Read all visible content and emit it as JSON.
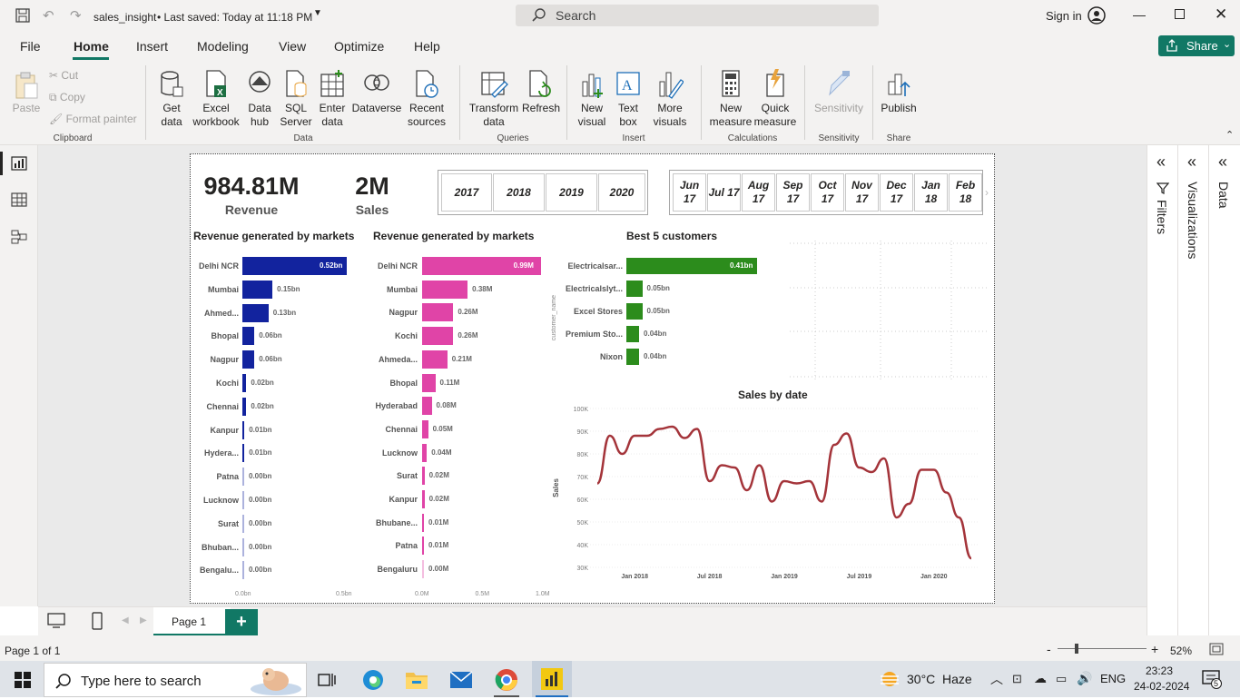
{
  "titlebar": {
    "file_name": "sales_insight",
    "saved_status": "• Last saved: Today at 11:18 PM",
    "search_placeholder": "Search",
    "sign_in": "Sign in"
  },
  "menu": {
    "tabs": [
      "File",
      "Home",
      "Insert",
      "Modeling",
      "View",
      "Optimize",
      "Help"
    ],
    "active_tab": "Home",
    "share_label": "Share"
  },
  "ribbon": {
    "clipboard": {
      "paste": "Paste",
      "cut": "Cut",
      "copy": "Copy",
      "format_painter": "Format painter",
      "group": "Clipboard"
    },
    "data": {
      "get_data": "Get data",
      "excel": "Excel workbook",
      "data_hub": "Data hub",
      "sql": "SQL Server",
      "enter_data": "Enter data",
      "dataverse": "Dataverse",
      "recent": "Recent sources",
      "group": "Data"
    },
    "queries": {
      "transform": "Transform data",
      "refresh": "Refresh",
      "group": "Queries"
    },
    "insert": {
      "new_visual": "New visual",
      "text_box": "Text box",
      "more_visuals": "More visuals",
      "group": "Insert"
    },
    "calculations": {
      "new_measure": "New measure",
      "quick_measure": "Quick measure",
      "group": "Calculations"
    },
    "sensitivity": {
      "label": "Sensitivity",
      "group": "Sensitivity"
    },
    "share": {
      "publish": "Publish",
      "group": "Share"
    }
  },
  "report": {
    "kpi_revenue": {
      "value": "984.81M",
      "label": "Revenue"
    },
    "kpi_sales": {
      "value": "2M",
      "label": "Sales"
    },
    "year_slicer": [
      "2017",
      "2018",
      "2019",
      "2020"
    ],
    "month_slicer": [
      "Jun 17",
      "Jul 17",
      "Aug 17",
      "Sep 17",
      "Oct 17",
      "Nov 17",
      "Dec 17",
      "Jan 18",
      "Feb 18"
    ]
  },
  "chart_data": [
    {
      "type": "bar",
      "title": "Revenue generated by markets",
      "categories": [
        "Delhi NCR",
        "Mumbai",
        "Ahmed...",
        "Bhopal",
        "Nagpur",
        "Kochi",
        "Chennai",
        "Kanpur",
        "Hydera...",
        "Patna",
        "Lucknow",
        "Surat",
        "Bhuban...",
        "Bengalu..."
      ],
      "values": [
        0.52,
        0.15,
        0.13,
        0.06,
        0.06,
        0.02,
        0.02,
        0.01,
        0.01,
        0.0,
        0.0,
        0.0,
        0.0,
        0.0
      ],
      "value_labels": [
        "0.52bn",
        "0.15bn",
        "0.13bn",
        "0.06bn",
        "0.06bn",
        "0.02bn",
        "0.02bn",
        "0.01bn",
        "0.01bn",
        "0.00bn",
        "0.00bn",
        "0.00bn",
        "0.00bn",
        "0.00bn"
      ],
      "xticks": [
        "0.0bn",
        "0.5bn"
      ],
      "xlim": [
        0,
        0.52
      ],
      "color": "#12239e"
    },
    {
      "type": "bar",
      "title": "Revenue generated by markets",
      "categories": [
        "Delhi NCR",
        "Mumbai",
        "Nagpur",
        "Kochi",
        "Ahmeda...",
        "Bhopal",
        "Hyderabad",
        "Chennai",
        "Lucknow",
        "Surat",
        "Kanpur",
        "Bhubane...",
        "Patna",
        "Bengaluru"
      ],
      "values": [
        0.99,
        0.38,
        0.26,
        0.26,
        0.21,
        0.11,
        0.08,
        0.05,
        0.04,
        0.02,
        0.02,
        0.01,
        0.01,
        0.0
      ],
      "value_labels": [
        "0.99M",
        "0.38M",
        "0.26M",
        "0.26M",
        "0.21M",
        "0.11M",
        "0.08M",
        "0.05M",
        "0.04M",
        "0.02M",
        "0.02M",
        "0.01M",
        "0.01M",
        "0.00M"
      ],
      "xticks": [
        "0.0M",
        "0.5M",
        "1.0M"
      ],
      "xlim": [
        0,
        1.0
      ],
      "color": "#e044a7"
    },
    {
      "type": "bar",
      "title": "Best 5 customers",
      "ylabel": "customer_name",
      "categories": [
        "Electricalsar...",
        "Electricalslyt...",
        "Excel Stores",
        "Premium Sto...",
        "Nixon"
      ],
      "values": [
        0.41,
        0.05,
        0.05,
        0.04,
        0.04
      ],
      "value_labels": [
        "0.41bn",
        "0.05bn",
        "0.05bn",
        "0.04bn",
        "0.04bn"
      ],
      "xlim": [
        0,
        0.41
      ],
      "color": "#2c8c1c"
    },
    {
      "type": "line",
      "title": "Sales by date",
      "ylabel": "Sales",
      "yticks": [
        "100K",
        "90K",
        "80K",
        "70K",
        "60K",
        "50K",
        "40K",
        "30K"
      ],
      "ylim": [
        30000,
        100000
      ],
      "xticks": [
        "Jan 2018",
        "Jul 2018",
        "Jan 2019",
        "Jul 2019",
        "Jan 2020"
      ],
      "x": [
        "2017-10",
        "2017-11",
        "2017-12",
        "2018-01",
        "2018-02",
        "2018-03",
        "2018-04",
        "2018-05",
        "2018-06",
        "2018-07",
        "2018-08",
        "2018-09",
        "2018-10",
        "2018-11",
        "2018-12",
        "2019-01",
        "2019-02",
        "2019-03",
        "2019-04",
        "2019-05",
        "2019-06",
        "2019-07",
        "2019-08",
        "2019-09",
        "2019-10",
        "2019-11",
        "2019-12",
        "2020-01",
        "2020-02",
        "2020-03",
        "2020-04",
        "2020-05",
        "2020-06"
      ],
      "values": [
        67000,
        88000,
        80000,
        88000,
        88000,
        91000,
        92000,
        87000,
        91000,
        68000,
        75000,
        74000,
        64000,
        75000,
        59000,
        68000,
        67000,
        68000,
        59000,
        84000,
        89000,
        74000,
        72000,
        78000,
        52000,
        58000,
        73000,
        73000,
        63000,
        52000,
        34000
      ],
      "color": "#a4343a"
    }
  ],
  "page_tabs": {
    "page1": "Page 1"
  },
  "statusbar": {
    "page_info": "Page 1 of 1",
    "zoom": "52%"
  },
  "taskbar": {
    "search_placeholder": "Type here to search",
    "weather_temp": "30°C",
    "weather_desc": "Haze",
    "lang": "ENG",
    "time": "23:23",
    "date": "24-02-2024",
    "notif_count": "5"
  },
  "panes": {
    "filters": "Filters",
    "visualizations": "Visualizations",
    "data": "Data"
  }
}
